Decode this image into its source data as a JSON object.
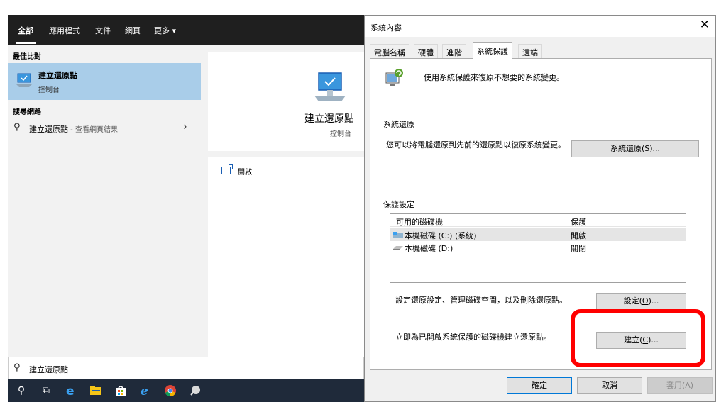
{
  "start_menu": {
    "tabs": [
      {
        "label": "全部"
      },
      {
        "label": "應用程式"
      },
      {
        "label": "文件"
      },
      {
        "label": "網頁"
      },
      {
        "label": "更多 ▾"
      }
    ],
    "best_match_title": "最佳比對",
    "best_match": {
      "title": "建立還原點",
      "subtitle": "控制台"
    },
    "web_title": "搜尋網路",
    "web_result": {
      "query": "建立還原點",
      "suffix": " - 查看網頁結果"
    },
    "preview": {
      "title": "建立還原點",
      "subtitle": "控制台"
    },
    "actions": [
      {
        "label": "開啟"
      }
    ],
    "search_box_text": "建立還原點"
  },
  "taskbar": {
    "icons": [
      "search-icon",
      "task-view-icon",
      "edge-icon",
      "file-explorer-icon",
      "store-icon",
      "ie-icon",
      "chrome-icon",
      "app-icon"
    ]
  },
  "dialog": {
    "title": "系統內容",
    "close_glyph": "✕",
    "tabs": [
      {
        "label": "電腦名稱"
      },
      {
        "label": "硬體"
      },
      {
        "label": "進階"
      },
      {
        "label": "系統保護"
      },
      {
        "label": "遠端"
      }
    ],
    "active_tab": "系統保護",
    "intro": "使用系統保護來復原不想要的系統變更。",
    "restore_group": {
      "title": "系統還原",
      "desc": "您可以將電腦還原到先前的還原點以復原系統變更。",
      "button_text": "系統還原(",
      "button_key": "S",
      "button_tail": ")..."
    },
    "protection_group": {
      "title": "保護設定",
      "columns": [
        "可用的磁碟機",
        "保護"
      ],
      "drives": [
        {
          "name": "本機磁碟 (C:) (系統)",
          "status": "開啟"
        },
        {
          "name": "本機磁碟 (D:)",
          "status": "關閉"
        }
      ],
      "configure_text": "設定還原設定、管理磁碟空間，以及刪除還原點。",
      "configure_button_text": "設定(",
      "configure_button_key": "O",
      "configure_button_tail": ")...",
      "create_text": "立即為已開啟系統保護的磁碟機建立還原點。",
      "create_button_text": "建立(",
      "create_button_key": "C",
      "create_button_tail": ")..."
    },
    "footer": {
      "ok": "確定",
      "cancel": "取消",
      "apply_text": "套用(",
      "apply_key": "A",
      "apply_tail": ")"
    }
  },
  "colors": {
    "accent_selection": "#a9cde9",
    "highlight_box": "#ff0000",
    "taskbar": "#1f2a3a",
    "start_topbar": "#1f1f1f"
  }
}
